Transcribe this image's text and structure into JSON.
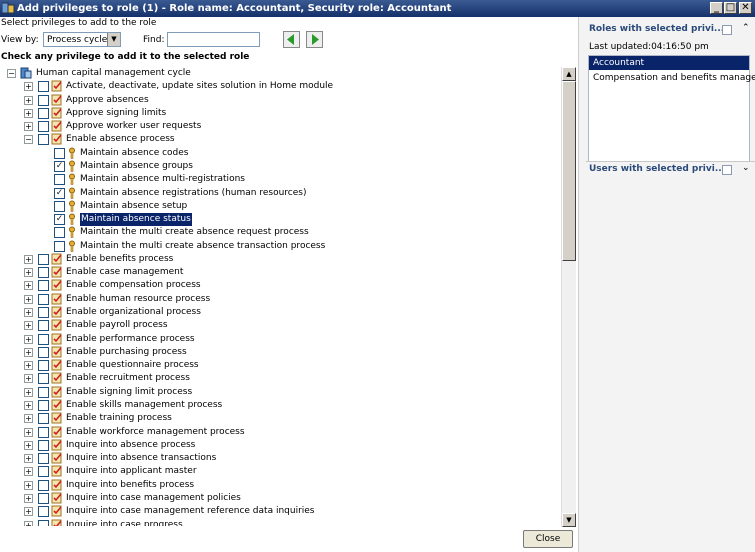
{
  "window": {
    "title": "Add privileges to role (1) - Role name: Accountant, Security role: Accountant",
    "minimize": "_",
    "maximize": "□",
    "close": "✕"
  },
  "main": {
    "instruction": "Select privileges to add to the role",
    "view_by_label": "View by:",
    "view_by_value": "Process cycle",
    "find_label": "Find:",
    "find_value": "",
    "check_heading": "Check any privilege to add it to the selected role",
    "close_label": "Close"
  },
  "tree": {
    "root": "Human capital management cycle",
    "items": [
      {
        "label": "Activate, deactivate, update sites solution in Home module",
        "level": 1,
        "expander": "+",
        "checked": false,
        "icon": "duty"
      },
      {
        "label": "Approve absences",
        "level": 1,
        "expander": "+",
        "checked": false,
        "icon": "duty"
      },
      {
        "label": "Approve signing limits",
        "level": 1,
        "expander": "+",
        "checked": false,
        "icon": "duty"
      },
      {
        "label": "Approve worker user requests",
        "level": 1,
        "expander": "+",
        "checked": false,
        "icon": "duty"
      },
      {
        "label": "Enable absence process",
        "level": 1,
        "expander": "-",
        "checked": false,
        "icon": "duty"
      },
      {
        "label": "Maintain absence codes",
        "level": 2,
        "expander": "",
        "checked": false,
        "icon": "key"
      },
      {
        "label": "Maintain absence groups",
        "level": 2,
        "expander": "",
        "checked": true,
        "icon": "key"
      },
      {
        "label": "Maintain absence multi-registrations",
        "level": 2,
        "expander": "",
        "checked": false,
        "icon": "key"
      },
      {
        "label": "Maintain absence registrations (human resources)",
        "level": 2,
        "expander": "",
        "checked": true,
        "icon": "key"
      },
      {
        "label": "Maintain absence setup",
        "level": 2,
        "expander": "",
        "checked": false,
        "icon": "key"
      },
      {
        "label": "Maintain absence status",
        "level": 2,
        "expander": "",
        "checked": true,
        "icon": "key",
        "selected": true
      },
      {
        "label": "Maintain the multi create absence request process",
        "level": 2,
        "expander": "",
        "checked": false,
        "icon": "key"
      },
      {
        "label": "Maintain the multi create absence transaction process",
        "level": 2,
        "expander": "",
        "checked": false,
        "icon": "key"
      },
      {
        "label": "Enable benefits process",
        "level": 1,
        "expander": "+",
        "checked": false,
        "icon": "duty"
      },
      {
        "label": "Enable case management",
        "level": 1,
        "expander": "+",
        "checked": false,
        "icon": "duty"
      },
      {
        "label": "Enable compensation process",
        "level": 1,
        "expander": "+",
        "checked": false,
        "icon": "duty"
      },
      {
        "label": "Enable human resource process",
        "level": 1,
        "expander": "+",
        "checked": false,
        "icon": "duty"
      },
      {
        "label": "Enable organizational process",
        "level": 1,
        "expander": "+",
        "checked": false,
        "icon": "duty"
      },
      {
        "label": "Enable payroll process",
        "level": 1,
        "expander": "+",
        "checked": false,
        "icon": "duty"
      },
      {
        "label": "Enable performance process",
        "level": 1,
        "expander": "+",
        "checked": false,
        "icon": "duty"
      },
      {
        "label": "Enable purchasing process",
        "level": 1,
        "expander": "+",
        "checked": false,
        "icon": "duty"
      },
      {
        "label": "Enable questionnaire process",
        "level": 1,
        "expander": "+",
        "checked": false,
        "icon": "duty"
      },
      {
        "label": "Enable recruitment process",
        "level": 1,
        "expander": "+",
        "checked": false,
        "icon": "duty"
      },
      {
        "label": "Enable signing limit process",
        "level": 1,
        "expander": "+",
        "checked": false,
        "icon": "duty"
      },
      {
        "label": "Enable skills management process",
        "level": 1,
        "expander": "+",
        "checked": false,
        "icon": "duty"
      },
      {
        "label": "Enable training process",
        "level": 1,
        "expander": "+",
        "checked": false,
        "icon": "duty"
      },
      {
        "label": "Enable workforce management process",
        "level": 1,
        "expander": "+",
        "checked": false,
        "icon": "duty"
      },
      {
        "label": "Inquire into absence process",
        "level": 1,
        "expander": "+",
        "checked": false,
        "icon": "duty"
      },
      {
        "label": "Inquire into absence transactions",
        "level": 1,
        "expander": "+",
        "checked": false,
        "icon": "duty"
      },
      {
        "label": "Inquire into applicant master",
        "level": 1,
        "expander": "+",
        "checked": false,
        "icon": "duty"
      },
      {
        "label": "Inquire into benefits process",
        "level": 1,
        "expander": "+",
        "checked": false,
        "icon": "duty"
      },
      {
        "label": "Inquire into case management policies",
        "level": 1,
        "expander": "+",
        "checked": false,
        "icon": "duty"
      },
      {
        "label": "Inquire into case management reference data inquiries",
        "level": 1,
        "expander": "+",
        "checked": false,
        "icon": "duty"
      },
      {
        "label": "Inquire into case progress",
        "level": 1,
        "expander": "+",
        "checked": false,
        "icon": "duty"
      }
    ]
  },
  "right_panel": {
    "roles_header": "Roles with selected privi...",
    "last_updated": "Last updated:04:16:50 pm",
    "roles": [
      {
        "label": "Accountant",
        "selected": true
      },
      {
        "label": "Compensation and benefits manager",
        "selected": false
      }
    ],
    "users_header": "Users with selected privi..."
  },
  "colors": {
    "titlebar": "#15306a",
    "selection": "#0a246a",
    "panel_header": "#2a4a7a"
  }
}
